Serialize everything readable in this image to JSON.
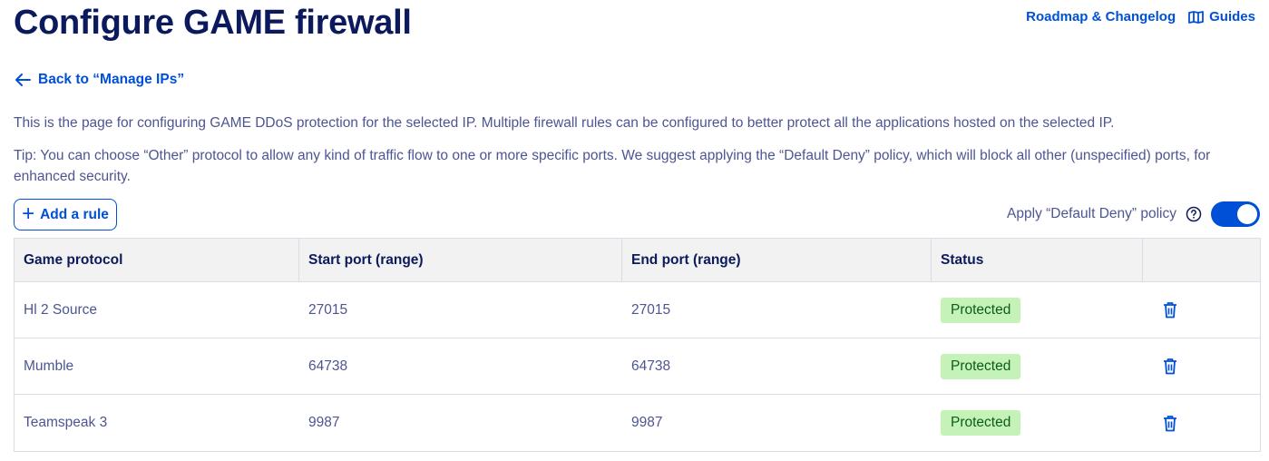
{
  "header": {
    "title": "Configure GAME firewall",
    "roadmap_link": "Roadmap & Changelog",
    "guides_link": "Guides"
  },
  "back_link": "Back to “Manage IPs”",
  "description": "This is the page for configuring GAME DDoS protection for the selected IP. Multiple firewall rules can be configured to better protect all the applications hosted on the selected IP.",
  "tip": "Tip: You can choose “Other” protocol to allow any kind of traffic flow to one or more specific ports. We suggest applying the “Default Deny” policy, which will block all other (unspecified) ports, for enhanced security.",
  "add_rule_label": "Add a rule",
  "policy": {
    "label": "Apply “Default Deny” policy",
    "enabled": true
  },
  "table": {
    "headers": [
      "Game protocol",
      "Start port (range)",
      "End port (range)",
      "Status",
      ""
    ],
    "rows": [
      {
        "protocol": "Hl 2 Source",
        "start": "27015",
        "end": "27015",
        "status": "Protected"
      },
      {
        "protocol": "Mumble",
        "start": "64738",
        "end": "64738",
        "status": "Protected"
      },
      {
        "protocol": "Teamspeak 3",
        "start": "9987",
        "end": "9987",
        "status": "Protected"
      }
    ]
  },
  "icons": {
    "back": "arrow-left-icon",
    "guides": "book-icon",
    "add": "plus-icon",
    "help": "help-circle-icon",
    "delete": "trash-icon"
  },
  "colors": {
    "accent": "#0050d7",
    "title": "#0b1a5c",
    "text": "#4d5592",
    "badge_bg": "#c5f2b6"
  }
}
